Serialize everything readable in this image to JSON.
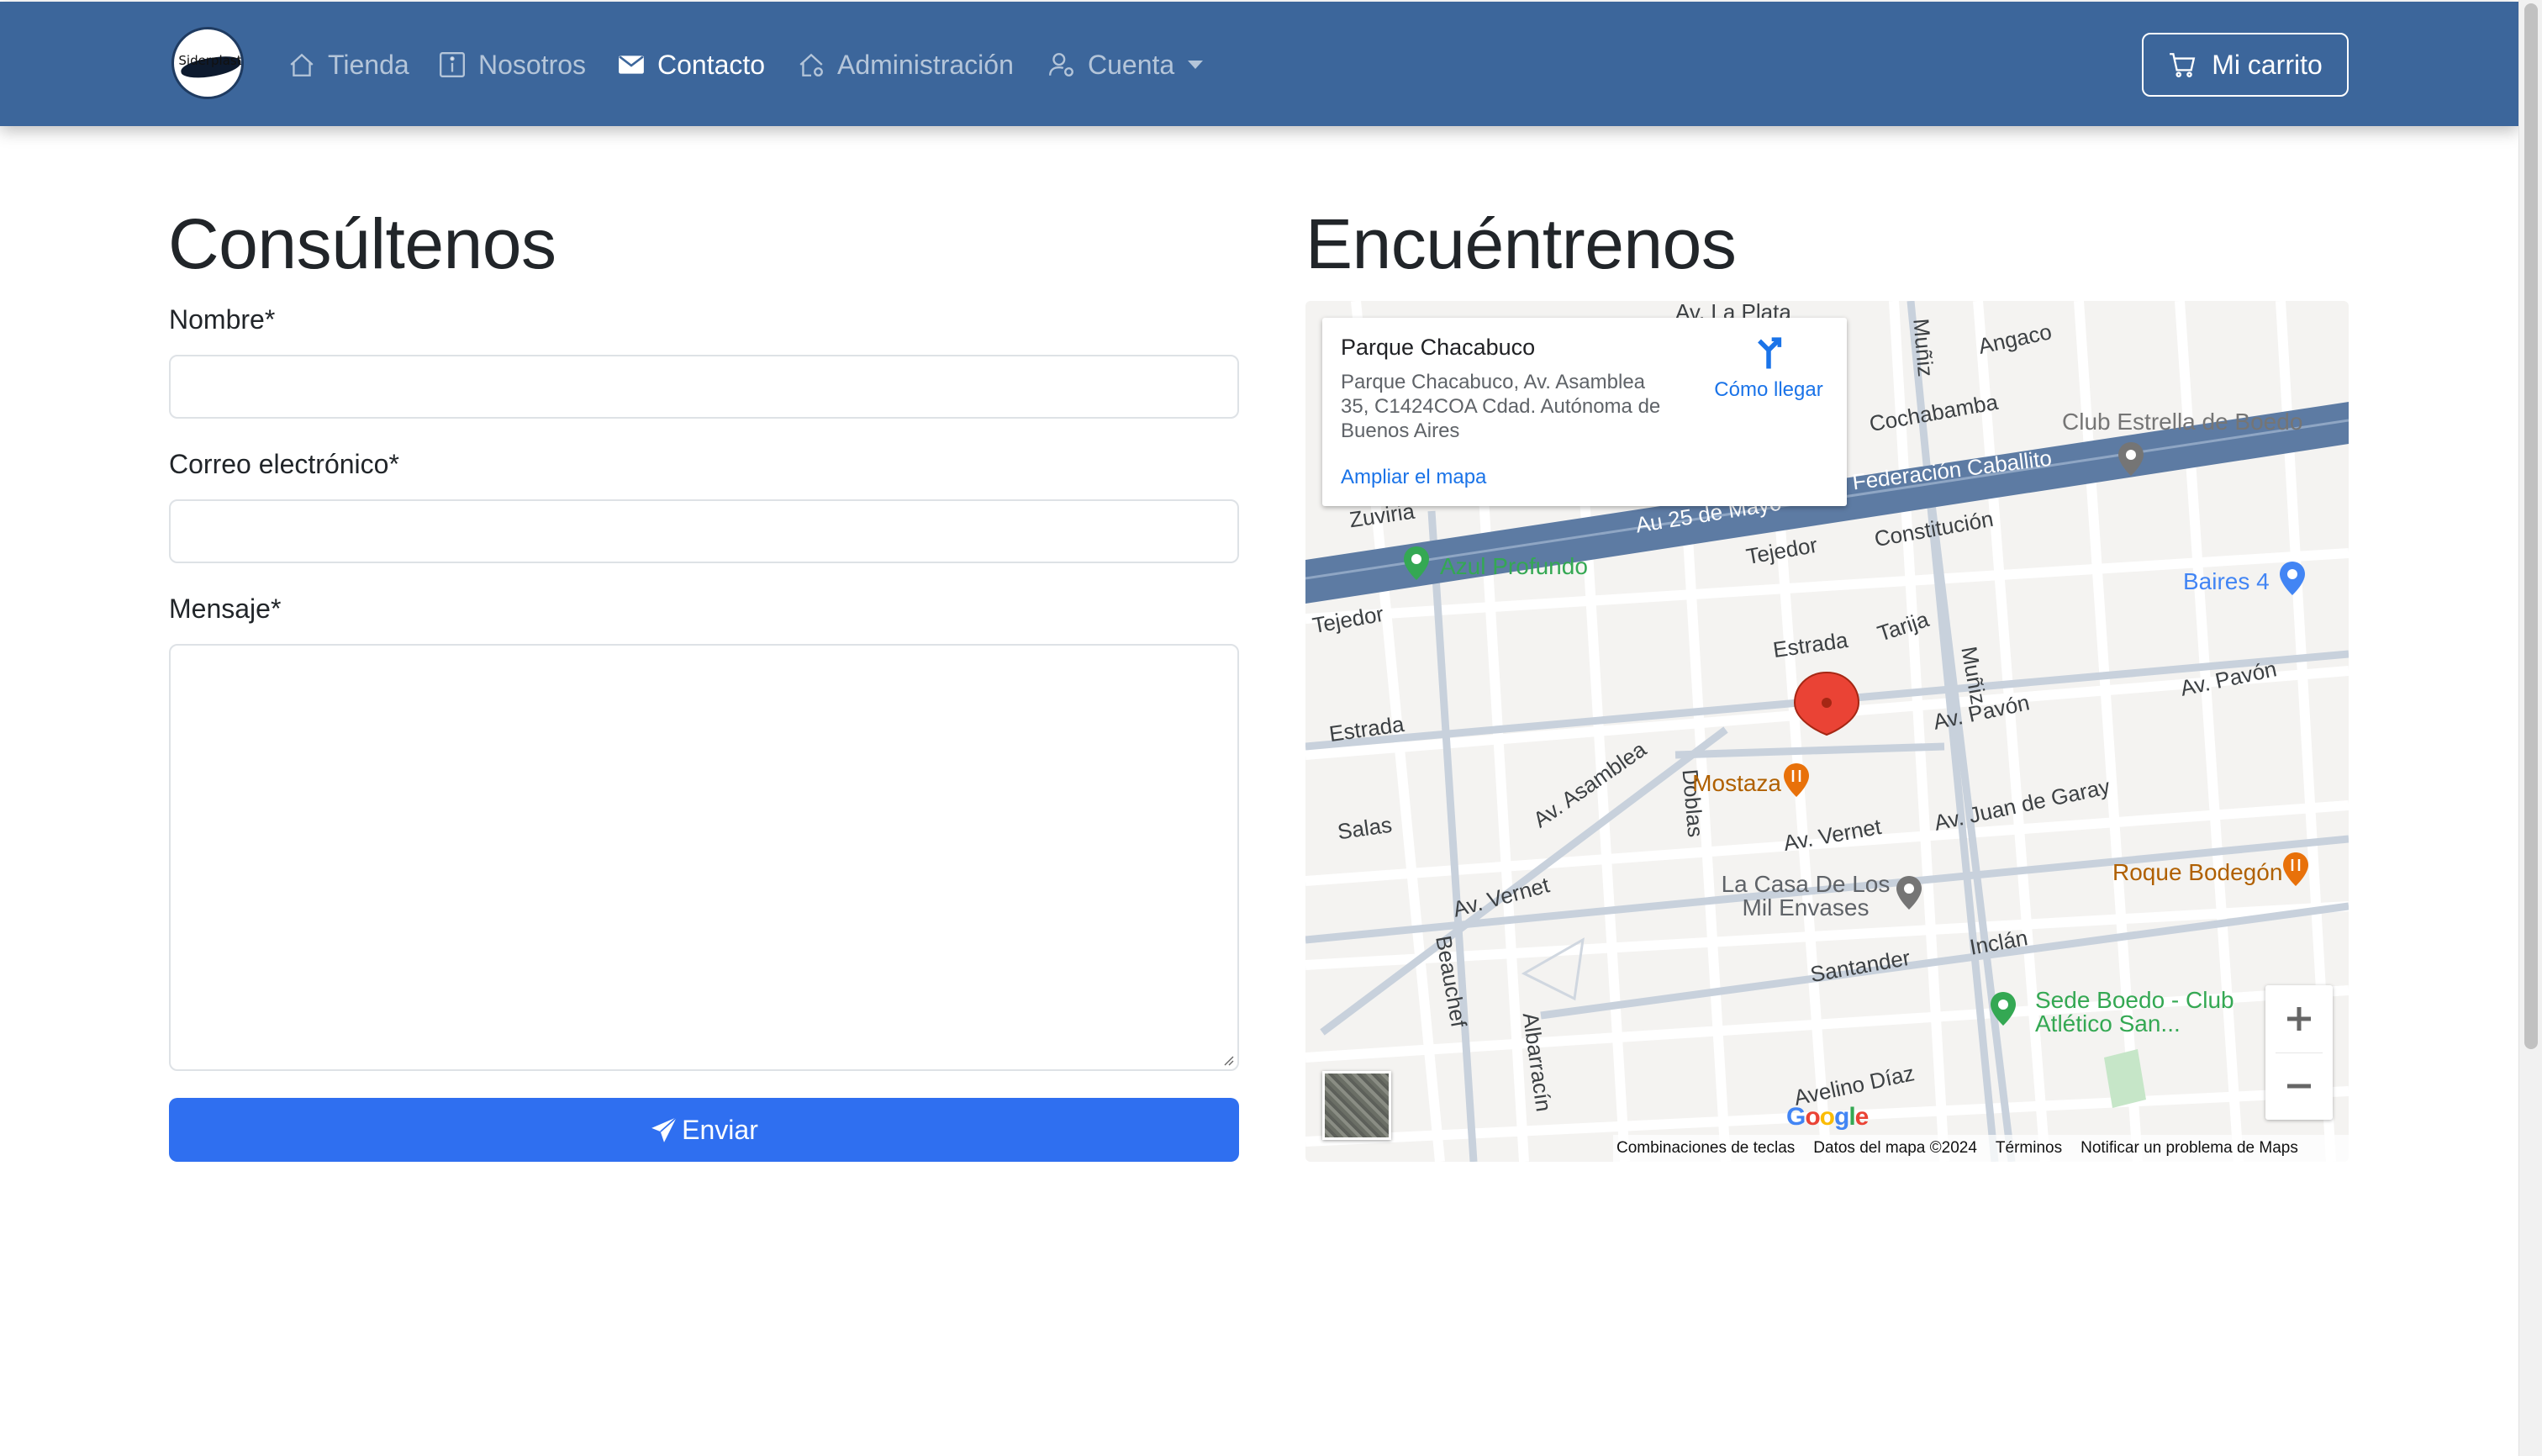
{
  "navbar": {
    "logo_text": "Siderplast",
    "items": [
      {
        "label": "Tienda",
        "icon": "house-icon",
        "active": false
      },
      {
        "label": "Nosotros",
        "icon": "info-square-icon",
        "active": false
      },
      {
        "label": "Contacto",
        "icon": "envelope-icon",
        "active": true
      },
      {
        "label": "Administración",
        "icon": "house-gear-icon",
        "active": false
      },
      {
        "label": "Cuenta",
        "icon": "person-gear-icon",
        "active": false
      }
    ],
    "cart_label": "Mi carrito"
  },
  "contact_form": {
    "title": "Consúltenos",
    "name_label": "Nombre*",
    "name_value": "",
    "email_label": "Correo electrónico*",
    "email_value": "",
    "message_label": "Mensaje*",
    "message_value": "",
    "submit_label": "Enviar"
  },
  "location": {
    "title": "Encuéntrenos",
    "map": {
      "place_name": "Parque Chacabuco",
      "place_address": "Parque Chacabuco, Av. Asamblea 35, C1424COA Cdad. Autónoma de Buenos Aires",
      "directions_label": "Cómo llegar",
      "enlarge_label": "Ampliar el mapa",
      "footer": {
        "shortcuts": "Combinaciones de teclas",
        "data": "Datos del mapa ©2024",
        "terms": "Términos",
        "report": "Notificar un problema de Maps"
      },
      "logo": "Google",
      "street_labels": [
        "Av. La Plata",
        "Muñiz",
        "Angaco",
        "Cochabamba",
        "Zuviria",
        "Au 25 de Mayo",
        "Tejedor",
        "Constitución",
        "Tejedor",
        "Estrada",
        "Tarija",
        "Muñiz",
        "Estrada",
        "Av. Pavón",
        "Av. Pavón",
        "Av. Asamblea",
        "Doblas",
        "Salas",
        "Av. Vernet",
        "Av. Juan de Garay",
        "Av. Vernet",
        "Beauchef",
        "Inclán",
        "Santander",
        "Albarracín",
        "Avelino Díaz",
        "Federación Caballito"
      ],
      "pois": [
        {
          "name": "Club Estrella de Boedo",
          "color": "#757575"
        },
        {
          "name": "Azul Profundo",
          "color": "#34a853"
        },
        {
          "name": "Baires 4",
          "color": "#4285f4"
        },
        {
          "name": "Mostaza",
          "color": "#e8710a"
        },
        {
          "name": "La Casa De Los Mil Envases",
          "color": "#757575"
        },
        {
          "name": "Roque Bodegón",
          "color": "#e8710a"
        },
        {
          "name": "Sede Boedo - Club Atlético San...",
          "color": "#34a853"
        }
      ],
      "zoom_in": "+",
      "zoom_out": "−"
    }
  },
  "colors": {
    "navbar_bg": "#3c669b",
    "primary_button": "#2f6ff0",
    "map_pin": "#ea4335"
  }
}
